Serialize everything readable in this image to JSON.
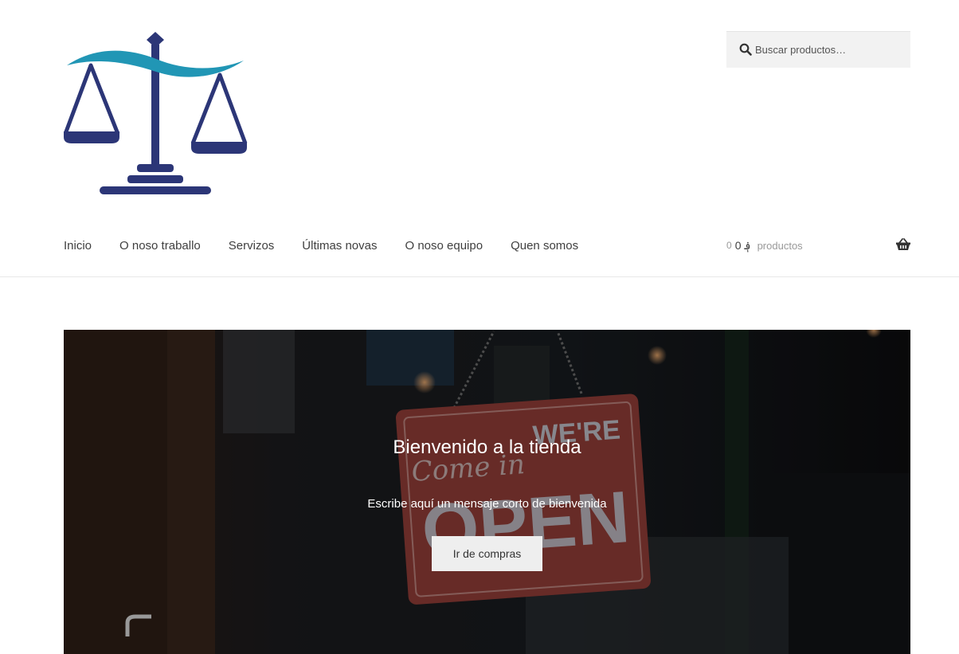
{
  "header": {
    "logo": "scales-of-justice-logo",
    "search": {
      "placeholder": "Buscar productos…",
      "icon": "search-icon"
    }
  },
  "nav": {
    "items": [
      {
        "label": "Inicio"
      },
      {
        "label": "O noso traballo"
      },
      {
        "label": "Servizos"
      },
      {
        "label": "Últimas novas"
      },
      {
        "label": "O noso equipo"
      },
      {
        "label": "Quen somos"
      }
    ]
  },
  "cart": {
    "amount": "0",
    "total": "0 ؋",
    "count_label": "productos",
    "icon": "basket-icon"
  },
  "hero": {
    "title": "Bienvenido a la tienda",
    "text": "Escribe aquí un mensaje corto de bienvenida",
    "button_label": "Ir de compras",
    "sign": {
      "line1": "Come in",
      "line2": "WE'RE",
      "line3": "OPEN"
    }
  },
  "colors": {
    "logo_navy": "#2c3677",
    "logo_wave": "#2196b5",
    "sign_red": "#8a3a35",
    "button_bg": "#eeeeee"
  }
}
